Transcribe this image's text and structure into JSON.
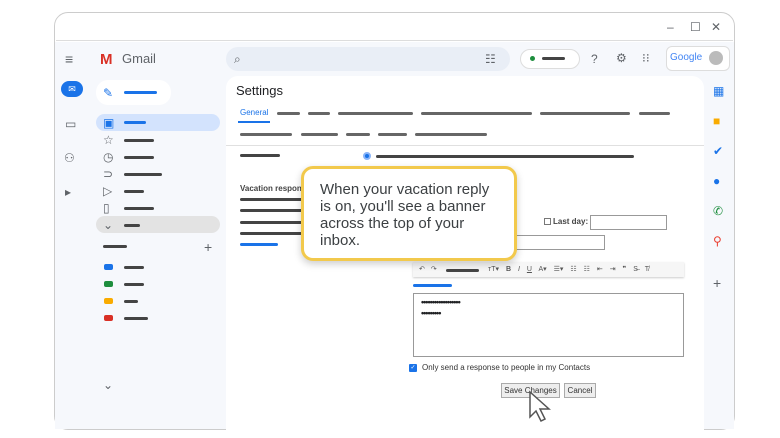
{
  "window": {
    "controls": [
      "minimize",
      "maximize",
      "close"
    ]
  },
  "header": {
    "app_name": "Gmail",
    "brand": "Google",
    "status_color": "#1e8e3e"
  },
  "settings": {
    "title": "Settings",
    "active_tab": "General",
    "vacation_label": "Vacation respon",
    "last_day_label": "Last day:",
    "message_line1": "••••••••••••••••••",
    "message_line2": "•••••••••",
    "contacts_only_label": "Only send a response to people in my Contacts",
    "save_label": "Save Changes",
    "cancel_label": "Cancel"
  },
  "callout": {
    "text": "When your vacation reply is on, you'll see a banner across the top of your inbox."
  },
  "labels": {
    "colors": [
      "#1a73e8",
      "#1e8e3e",
      "#f9ab00",
      "#d93025"
    ]
  },
  "colors": {
    "accent": "#1a73e8",
    "callout_border": "#f2c94c"
  }
}
